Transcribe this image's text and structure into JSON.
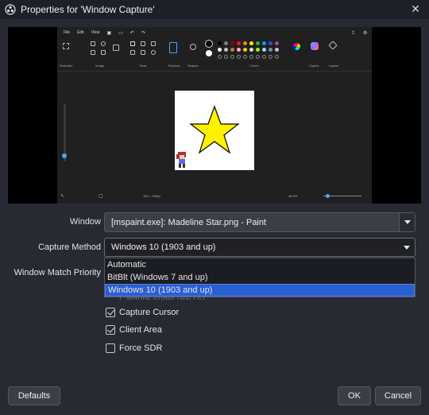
{
  "window": {
    "title": "Properties for 'Window Capture'"
  },
  "preview": {
    "paint": {
      "menus": [
        "File",
        "Edit",
        "View"
      ],
      "group_labels": [
        "Selection",
        "Image",
        "Tools",
        "Brushes",
        "Shapes",
        "Colors",
        "Copilot",
        "Layers"
      ],
      "status": {
        "dimensions": "100 × 100px",
        "zoom": "44.5%"
      },
      "palette": [
        "#000000",
        "#7f7f7f",
        "#880015",
        "#ed1c24",
        "#ff7f27",
        "#fff200",
        "#22b14c",
        "#00a2e8",
        "#3f48cc",
        "#a349a4",
        "#ffffff",
        "#c3c3c3",
        "#b97a57",
        "#ffaec9",
        "#ffc90e",
        "#efe4b0",
        "#b5e61d",
        "#99d9ea",
        "#7092be",
        "#c8bfe7"
      ]
    }
  },
  "form": {
    "window_label": "Window",
    "window_value": "[mspaint.exe]: Madeline Star.png - Paint",
    "capture_method_label": "Capture Method",
    "capture_method_value": "Windows 10 (1903 and up)",
    "window_match_label": "Window Match Priority",
    "capture_method_options": [
      "Automatic",
      "BitBlt (Windows 7 and up)",
      "Windows 10 (1903 and up)"
    ],
    "hidden_partial_label": "Capture Audio (BETA)",
    "checkboxes": [
      {
        "label": "Capture Cursor",
        "checked": true
      },
      {
        "label": "Client Area",
        "checked": true
      },
      {
        "label": "Force SDR",
        "checked": false
      }
    ]
  },
  "buttons": {
    "defaults": "Defaults",
    "ok": "OK",
    "cancel": "Cancel"
  },
  "colors": {
    "dialog_bg": "#272a33",
    "selection": "#2b5ed1",
    "star_fill": "#fff200"
  }
}
